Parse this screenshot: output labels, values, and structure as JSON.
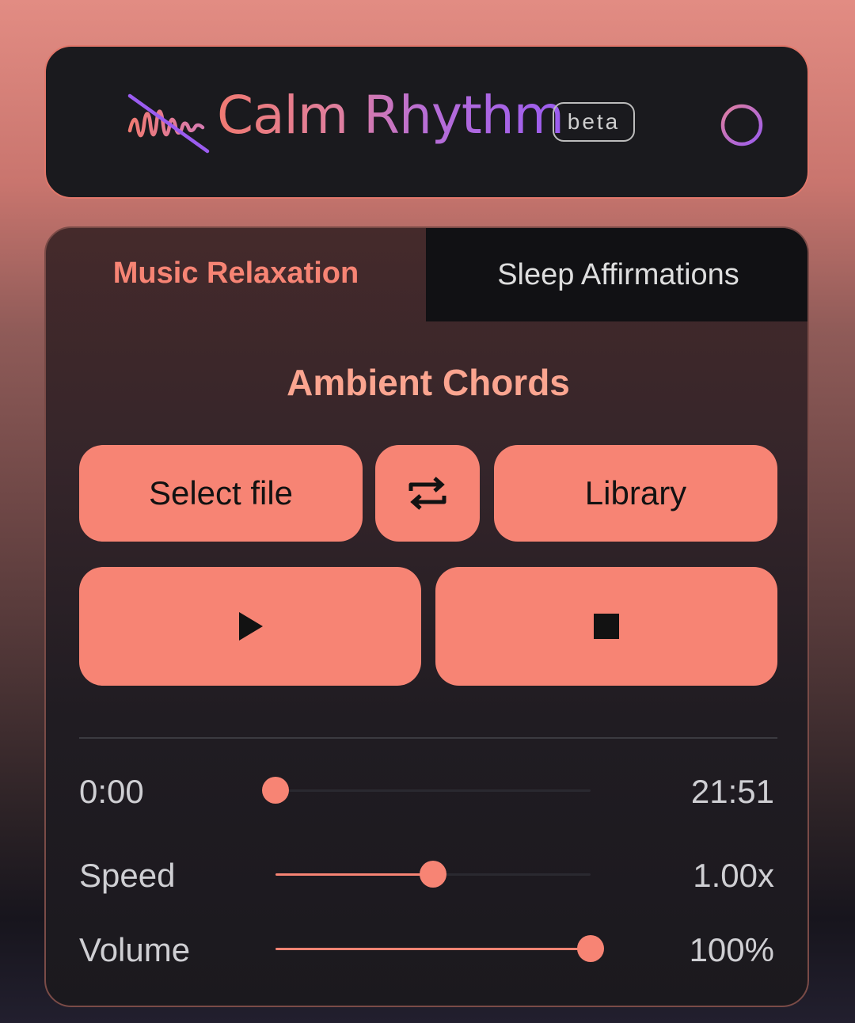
{
  "header": {
    "title": "Calm Rhythm",
    "badge": "beta",
    "logo_icon": "waveform-slash-icon",
    "info_icon": "info-icon"
  },
  "tabs": [
    {
      "label": "Music Relaxation",
      "active": true
    },
    {
      "label": "Sleep Affirmations",
      "active": false
    }
  ],
  "player": {
    "track_title": "Ambient Chords",
    "select_file_label": "Select file",
    "repeat_icon": "repeat-icon",
    "library_label": "Library",
    "play_icon": "play-icon",
    "stop_icon": "stop-icon"
  },
  "progress": {
    "current_time": "0:00",
    "total_time": "21:51",
    "fraction": 0
  },
  "speed": {
    "label": "Speed",
    "value_text": "1.00x",
    "fraction": 0.5
  },
  "volume": {
    "label": "Volume",
    "value_text": "100%",
    "fraction": 1
  },
  "colors": {
    "accent": "#f78474",
    "panel": "#1a1a1e",
    "tab_inactive_bg": "#111114",
    "title_gradient_start": "#f07a72",
    "title_gradient_end": "#9b5cf0"
  }
}
